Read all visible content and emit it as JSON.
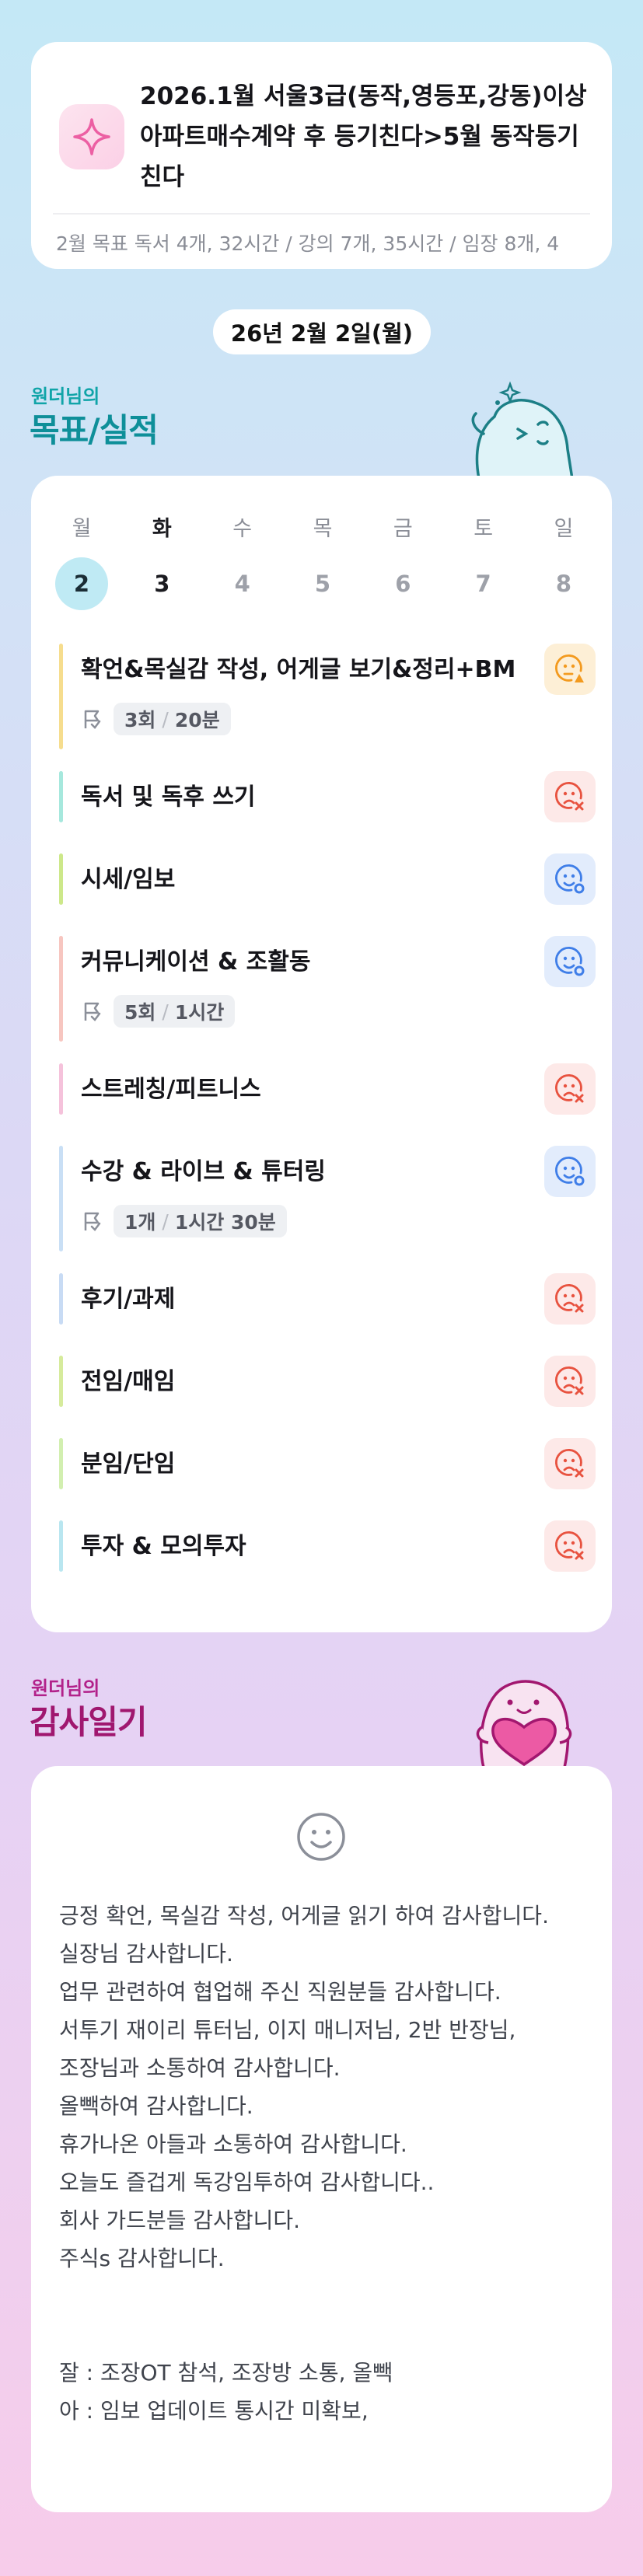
{
  "goal": {
    "title": "2026.1월 서울3급(동작,영등포,강동)이상 아파트매수계약 후 등기친다>5월 동작등기친다",
    "summary": "2월 목표  독서 4개, 32시간 / 강의 7개, 35시간 / 임장 8개, 4",
    "icon": "sparkle-icon"
  },
  "date_label": "26년 2월 2일(월)",
  "section_goals": {
    "subtitle": "원더님의",
    "title": "목표/실적"
  },
  "week": {
    "days": [
      "월",
      "화",
      "수",
      "목",
      "금",
      "토",
      "일"
    ],
    "dates": [
      "2",
      "3",
      "4",
      "5",
      "6",
      "7",
      "8"
    ]
  },
  "tasks": [
    {
      "name": "확언&목실감 작성, 어게글 보기&정리+BM작성",
      "count": "3회",
      "time": "20분",
      "status": "partial",
      "bar_color": "#f6dd8e"
    },
    {
      "name": "독서 및 독후 쓰기",
      "status": "fail",
      "bar_color": "#a6e8dd"
    },
    {
      "name": "시세/임보",
      "status": "done",
      "bar_color": "#cde88a"
    },
    {
      "name": "커뮤니케이션 & 조활동",
      "count": "5회",
      "time": "1시간",
      "status": "done",
      "bar_color": "#f7c6c0"
    },
    {
      "name": "스트레칭/피트니스",
      "status": "fail",
      "bar_color": "#f5c2db"
    },
    {
      "name": "수강 & 라이브 & 튜터링",
      "count": "1개",
      "time": "1시간 30분",
      "status": "done",
      "bar_color": "#c9dff5"
    },
    {
      "name": "후기/과제",
      "status": "fail",
      "bar_color": "#c8dbf4"
    },
    {
      "name": "전임/매임",
      "status": "fail",
      "bar_color": "#d6eb9c"
    },
    {
      "name": "분임/단임",
      "status": "fail",
      "bar_color": "#d2efb0"
    },
    {
      "name": "투자 & 모의투자",
      "status": "fail",
      "bar_color": "#b9e6f0"
    }
  ],
  "section_gratitude": {
    "subtitle": "원더님의",
    "title": "감사일기"
  },
  "journal": {
    "mood_icon": "smile-face-icon",
    "text": "긍정 확언, 목실감 작성, 어게글 읽기 하여 감사합니다.\n실장님 감사합니다.\n업무 관련하여 협업해 주신 직원분들 감사합니다.\n서투기 재이리 튜터님, 이지 매니저님, 2반 반장님, 조장님과 소통하여 감사합니다.\n올빽하여 감사합니다.\n휴가나온 아들과 소통하여 감사합니다.\n오늘도 즐겁게 독강임투하여 감사합니다..\n회사 가드분들 감사합니다.\n주식s 감사합니다.\n\n\n잘 : 조장OT 참석, 조장방 소통, 올빽\n아 : 임보 업데이트 통시간 미확보,"
  },
  "colors": {
    "fail": "#e8523f",
    "partial": "#f39a1e",
    "done": "#3f7ee8"
  }
}
